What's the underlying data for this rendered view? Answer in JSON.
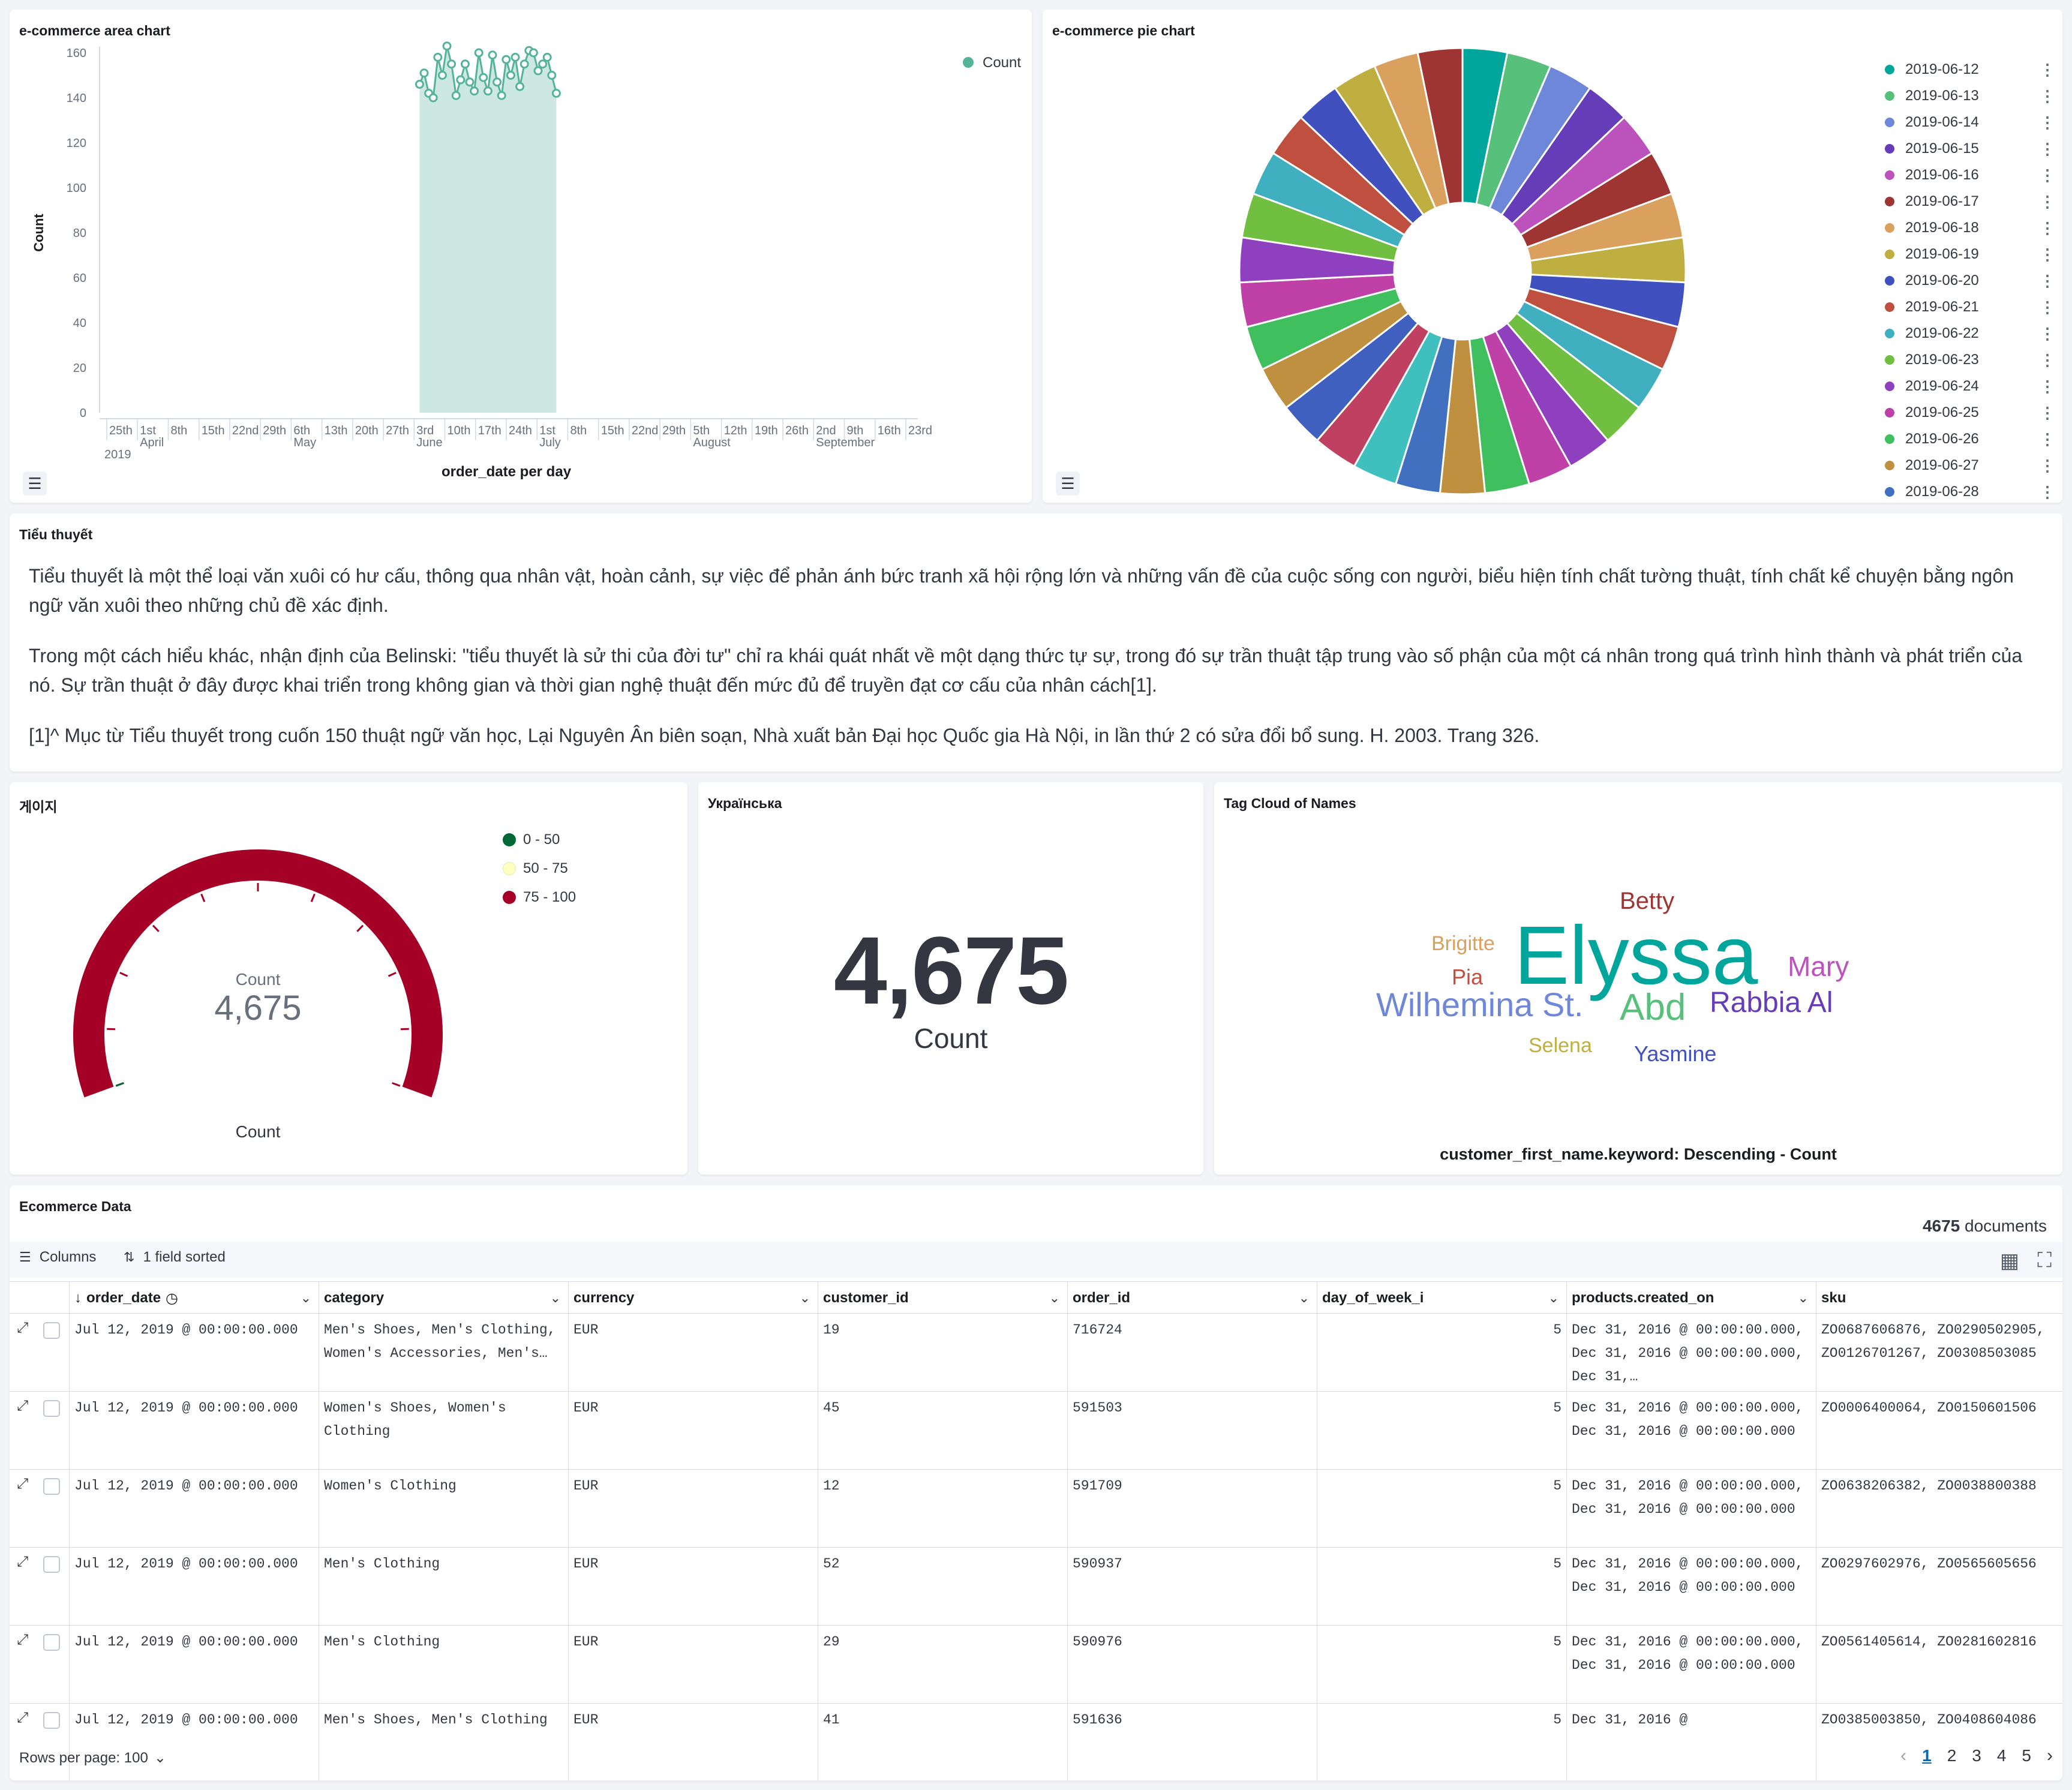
{
  "area_panel": {
    "title": "e-commerce area chart",
    "ylabel": "Count",
    "xlabel": "order_date per day",
    "legend": "Count",
    "y_ticks": [
      "0",
      "20",
      "40",
      "60",
      "80",
      "100",
      "120",
      "140",
      "160"
    ],
    "x_ticks": [
      "25th",
      "1st",
      "8th",
      "15th",
      "22nd",
      "29th",
      "6th",
      "13th",
      "20th",
      "27th",
      "3rd",
      "10th",
      "17th",
      "24th",
      "1st",
      "8th",
      "15th",
      "22nd",
      "29th",
      "5th",
      "12th",
      "19th",
      "26th",
      "2nd",
      "9th",
      "16th",
      "23rd"
    ],
    "x_sub": [
      "2019",
      "April",
      "May",
      "June",
      "July",
      "August",
      "September"
    ]
  },
  "pie_panel": {
    "title": "e-commerce pie chart",
    "legend": [
      {
        "label": "2019-06-12",
        "color": "#00a69b"
      },
      {
        "label": "2019-06-13",
        "color": "#57c17b"
      },
      {
        "label": "2019-06-14",
        "color": "#6f87d8"
      },
      {
        "label": "2019-06-15",
        "color": "#663db8"
      },
      {
        "label": "2019-06-16",
        "color": "#bc52bc"
      },
      {
        "label": "2019-06-17",
        "color": "#9e3533"
      },
      {
        "label": "2019-06-18",
        "color": "#daa05d"
      },
      {
        "label": "2019-06-19",
        "color": "#bfaf40"
      },
      {
        "label": "2019-06-20",
        "color": "#4050bf"
      },
      {
        "label": "2019-06-21",
        "color": "#bf5040"
      },
      {
        "label": "2019-06-22",
        "color": "#40afbf"
      },
      {
        "label": "2019-06-23",
        "color": "#70bf40"
      },
      {
        "label": "2019-06-24",
        "color": "#8f40bf"
      },
      {
        "label": "2019-06-25",
        "color": "#bf40a7"
      },
      {
        "label": "2019-06-26",
        "color": "#40bf5f"
      },
      {
        "label": "2019-06-27",
        "color": "#bf9040"
      },
      {
        "label": "2019-06-28",
        "color": "#4070bf"
      }
    ]
  },
  "markdown_panel": {
    "title": "Tiểu thuyết",
    "p1": "Tiểu thuyết là một thể loại văn xuôi có hư cấu, thông qua nhân vật, hoàn cảnh, sự việc để phản ánh bức tranh xã hội rộng lớn và những vấn đề của cuộc sống con người, biểu hiện tính chất tường thuật, tính chất kể chuyện bằng ngôn ngữ văn xuôi theo những chủ đề xác định.",
    "p2": "Trong một cách hiểu khác, nhận định của Belinski: \"tiểu thuyết là sử thi của đời tư\" chỉ ra khái quát nhất về một dạng thức tự sự, trong đó sự trần thuật tập trung vào số phận của một cá nhân trong quá trình hình thành và phát triển của nó. Sự trần thuật ở đây được khai triển trong không gian và thời gian nghệ thuật đến mức đủ để truyền đạt cơ cấu của nhân cách[1].",
    "p3": "[1]^ Mục từ Tiểu thuyết trong cuốn 150 thuật ngữ văn học, Lại Nguyên Ân biên soạn, Nhà xuất bản Đại học Quốc gia Hà Nội, in lần thứ 2 có sửa đổi bổ sung. H. 2003. Trang 326."
  },
  "gauge_panel": {
    "title": "게이지",
    "inner_label": "Count",
    "value": "4,675",
    "bottom_label": "Count",
    "level_percent": 100,
    "legend": [
      {
        "label": "0 - 50",
        "color": "#006837"
      },
      {
        "label": "50 - 75",
        "color": "#ffffbf"
      },
      {
        "label": "75 - 100",
        "color": "#a50026"
      }
    ]
  },
  "metric_panel": {
    "title": "Українська",
    "value": "4,675",
    "label": "Count"
  },
  "tagcloud_panel": {
    "title": "Tag Cloud of Names",
    "footer": "customer_first_name.keyword: Descending - Count",
    "tags": [
      {
        "text": "Elyssa",
        "color": "#00a69b"
      },
      {
        "text": "Betty",
        "color": "#9e3533"
      },
      {
        "text": "Brigitte",
        "color": "#daa05d"
      },
      {
        "text": "Mary",
        "color": "#bc52bc"
      },
      {
        "text": "Pia",
        "color": "#bf5040"
      },
      {
        "text": "Wilhemina St.",
        "color": "#6f87d8"
      },
      {
        "text": "Abd",
        "color": "#57c17b"
      },
      {
        "text": "Rabbia Al",
        "color": "#663db8"
      },
      {
        "text": "Selena",
        "color": "#bfaf40"
      },
      {
        "text": "Yasmine",
        "color": "#4050bf"
      }
    ]
  },
  "table_panel": {
    "title": "Ecommerce Data",
    "doc_count": "4675",
    "doc_suffix": " documents",
    "columns_btn": "Columns",
    "sorted_btn": "1 field sorted",
    "headers": [
      "order_date",
      "category",
      "currency",
      "customer_id",
      "order_id",
      "day_of_week_i",
      "products.created_on",
      "sku"
    ],
    "rows": [
      [
        "Jul 12, 2019 @ 00:00:00.000",
        "Men's Shoes, Men's Clothing, Women's Accessories, Men's…",
        "EUR",
        "19",
        "716724",
        "5",
        "Dec 31, 2016 @ 00:00:00.000, Dec 31, 2016 @ 00:00:00.000, Dec 31,…",
        "ZO0687606876, ZO0290502905, ZO0126701267, ZO0308503085"
      ],
      [
        "Jul 12, 2019 @ 00:00:00.000",
        "Women's Shoes, Women's Clothing",
        "EUR",
        "45",
        "591503",
        "5",
        "Dec 31, 2016 @ 00:00:00.000, Dec 31, 2016 @ 00:00:00.000",
        "ZO0006400064, ZO0150601506"
      ],
      [
        "Jul 12, 2019 @ 00:00:00.000",
        "Women's Clothing",
        "EUR",
        "12",
        "591709",
        "5",
        "Dec 31, 2016 @ 00:00:00.000, Dec 31, 2016 @ 00:00:00.000",
        "ZO0638206382, ZO0038800388"
      ],
      [
        "Jul 12, 2019 @ 00:00:00.000",
        "Men's Clothing",
        "EUR",
        "52",
        "590937",
        "5",
        "Dec 31, 2016 @ 00:00:00.000, Dec 31, 2016 @ 00:00:00.000",
        "ZO0297602976, ZO0565605656"
      ],
      [
        "Jul 12, 2019 @ 00:00:00.000",
        "Men's Clothing",
        "EUR",
        "29",
        "590976",
        "5",
        "Dec 31, 2016 @ 00:00:00.000, Dec 31, 2016 @ 00:00:00.000",
        "ZO0561405614, ZO0281602816"
      ],
      [
        "Jul 12, 2019 @ 00:00:00.000",
        "Men's Shoes, Men's Clothing",
        "EUR",
        "41",
        "591636",
        "5",
        "Dec 31, 2016 @",
        "ZO0385003850, ZO0408604086"
      ]
    ],
    "rows_per_page": "Rows per page: 100",
    "pages": [
      "1",
      "2",
      "3",
      "4",
      "5"
    ]
  },
  "chart_data": [
    {
      "type": "area",
      "title": "e-commerce area chart",
      "xlabel": "order_date per day",
      "ylabel": "Count",
      "ylim": [
        0,
        160
      ],
      "series": [
        {
          "name": "Count",
          "x": [
            "2019-06-12",
            "2019-06-13",
            "2019-06-14",
            "2019-06-15",
            "2019-06-16",
            "2019-06-17",
            "2019-06-18",
            "2019-06-19",
            "2019-06-20",
            "2019-06-21",
            "2019-06-22",
            "2019-06-23",
            "2019-06-24",
            "2019-06-25",
            "2019-06-26",
            "2019-06-27",
            "2019-06-28",
            "2019-06-29",
            "2019-06-30",
            "2019-07-01",
            "2019-07-02",
            "2019-07-03",
            "2019-07-04",
            "2019-07-05",
            "2019-07-06",
            "2019-07-07",
            "2019-07-08",
            "2019-07-09",
            "2019-07-10",
            "2019-07-11",
            "2019-07-12"
          ],
          "values": [
            146,
            151,
            142,
            140,
            158,
            150,
            163,
            155,
            141,
            148,
            155,
            147,
            143,
            160,
            149,
            143,
            159,
            147,
            141,
            157,
            150,
            158,
            145,
            155,
            161,
            160,
            152,
            155,
            158,
            150,
            142
          ]
        }
      ],
      "legend": "top-right",
      "grid": false
    },
    {
      "type": "pie",
      "title": "e-commerce pie chart",
      "donut": true,
      "slices_count": 31,
      "legend": "right"
    }
  ]
}
